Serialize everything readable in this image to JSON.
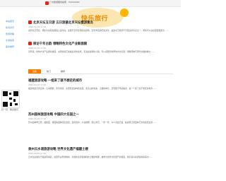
{
  "topbar": {
    "text": "广州旅游服务指南 · 5XXX2600"
  },
  "banner": {
    "text": "快乐旅行"
  },
  "sidebar": {
    "items": [
      {
        "label": "本站首页"
      },
      {
        "label": "新闻资讯"
      },
      {
        "label": "旅游攻略"
      },
      {
        "label": "交通指南"
      },
      {
        "label": "美食推荐"
      }
    ]
  },
  "qr": {
    "caption_left": "扫一扫",
    "caption_right": "联系我们"
  },
  "articles": [
    {
      "title": "北京天坛五日游 五日游遍北京天坛慢游景点",
      "meta": "2020-04-22 17:20",
      "summary": "说到北京天坛，相信许多朋友都会心生向往。这里不仅有宏伟的古建筑，还有丰富的历史文化，是来北京旅游不可错过的景点之一，游客可以在这里慢慢游览……"
    },
    {
      "title": "探访千年古韵 领略特色文化产业新面貌",
      "meta": "2020-04-22 17:20",
      "summary": "近年来，各地文化产业蓬勃发展，古老的技艺焕发出新的生机。走进这些特色小镇，可以感受到浓厚的文化氛围，领略传统与现代交融的魅力……"
    },
    {
      "title": "福建旅游攻略 一组来了就不想走的城市",
      "meta": "2020-04-22 17:20",
      "summary": "福建地处东南沿海，山海相依，风景秀丽。这里有鼓浪屿的浪漫、武夷山的秀美、土楼的神奇，还有数不尽的美食，是一个来了就不想走的地方……"
    },
    {
      "title": "苏州园林旅游攻略 中国四大名园之一",
      "meta": "2020-04-22 17:20",
      "summary": "苏州园林甲江南，拙政园、留园等园林闻名遐迩。漫步其中，亭台楼阁、假山池沼，一步一景，令人流连忘返，是感受江南园林艺术的最佳去处……"
    },
    {
      "title": "泉州云水谣旅游攻略 世界文化遗产福建土楼",
      "meta": "2020-04-22 17:20",
      "summary": "云水谣古镇位于福建南靖县，这里有古老的榕树、清澈的溪流和独特的土楼建筑群，被誉为世界文化遗产的瑰宝，吸引着众多游客前来探访……"
    }
  ],
  "tabs": [
    {
      "label": "最新"
    },
    {
      "label": "热门"
    },
    {
      "label": "推荐"
    }
  ]
}
